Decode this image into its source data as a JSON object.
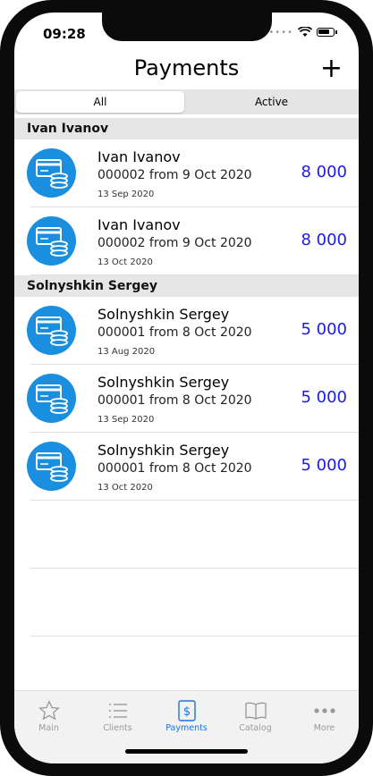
{
  "status": {
    "time": "09:28"
  },
  "header": {
    "title": "Payments",
    "add_label": "+"
  },
  "segments": {
    "all": "All",
    "active": "Active"
  },
  "groups": [
    {
      "name": "Ivan Ivanov",
      "items": [
        {
          "name": "Ivan Ivanov",
          "doc": "000002 from 9 Oct 2020",
          "date": "13 Sep 2020",
          "amount": "8 000"
        },
        {
          "name": "Ivan Ivanov",
          "doc": "000002 from 9 Oct 2020",
          "date": "13 Oct 2020",
          "amount": "8 000"
        }
      ]
    },
    {
      "name": "Solnyshkin Sergey",
      "items": [
        {
          "name": "Solnyshkin Sergey",
          "doc": "000001 from 8 Oct 2020",
          "date": "13 Aug 2020",
          "amount": "5 000"
        },
        {
          "name": "Solnyshkin Sergey",
          "doc": "000001 from 8 Oct 2020",
          "date": "13 Sep 2020",
          "amount": "5 000"
        },
        {
          "name": "Solnyshkin Sergey",
          "doc": "000001 from 8 Oct 2020",
          "date": "13 Oct 2020",
          "amount": "5 000"
        }
      ]
    }
  ],
  "tabs": [
    {
      "label": "Main",
      "icon": "star-icon"
    },
    {
      "label": "Clients",
      "icon": "list-icon"
    },
    {
      "label": "Payments",
      "icon": "dollar-icon"
    },
    {
      "label": "Catalog",
      "icon": "book-icon"
    },
    {
      "label": "More",
      "icon": "more-icon"
    }
  ],
  "colors": {
    "accent": "#1a73e8",
    "amount": "#1a1aee",
    "avatar": "#1a8fe0"
  }
}
